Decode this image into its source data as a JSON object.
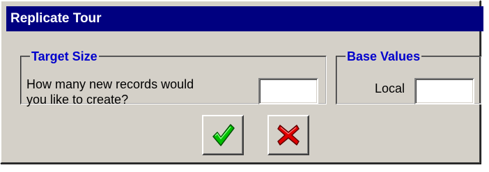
{
  "window": {
    "title": "Replicate Tour"
  },
  "target_size": {
    "legend": "Target Size",
    "question_line1": "How many new records would",
    "question_line2": "you like to create?",
    "records_value": ""
  },
  "base_values": {
    "legend": "Base Values",
    "local_label": "Local",
    "local_value": ""
  },
  "buttons": {
    "ok_icon": "green-checkmark-icon",
    "cancel_icon": "red-x-icon"
  },
  "colors": {
    "titlebar": "#000080",
    "legend_text": "#0000cc",
    "window_bg": "#d4d0c8",
    "check_green": "#00b000",
    "cross_red": "#e00000"
  }
}
